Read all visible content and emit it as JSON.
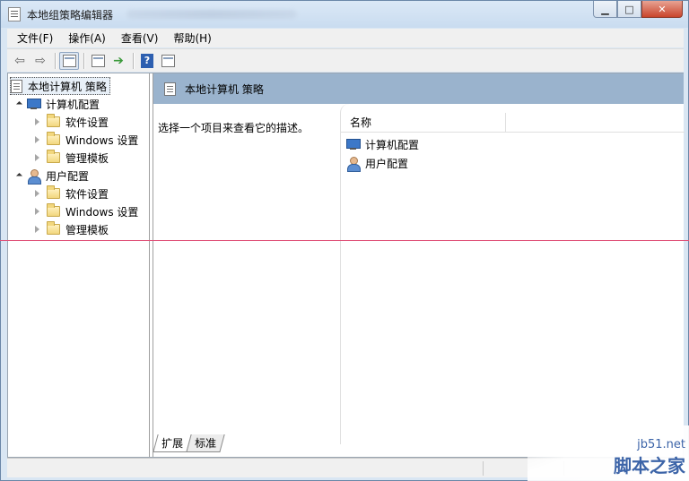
{
  "window": {
    "title": "本地组策略编辑器"
  },
  "window_buttons": {
    "minimize": "▁",
    "maximize": "□",
    "close": "✕"
  },
  "menu": [
    "文件(F)",
    "操作(A)",
    "查看(V)",
    "帮助(H)"
  ],
  "toolbar": {
    "back_icon": "back-arrow-icon",
    "forward_icon": "forward-arrow-icon",
    "help_label": "?"
  },
  "tree": {
    "root": "本地计算机 策略",
    "computer": {
      "label": "计算机配置",
      "children": [
        "软件设置",
        "Windows 设置",
        "管理模板"
      ]
    },
    "user": {
      "label": "用户配置",
      "children": [
        "软件设置",
        "Windows 设置",
        "管理模板"
      ]
    }
  },
  "right_pane": {
    "banner_title": "本地计算机 策略",
    "description": "选择一个项目来查看它的描述。",
    "column_header": "名称",
    "items": [
      "计算机配置",
      "用户配置"
    ]
  },
  "tabs": [
    "扩展",
    "标准"
  ],
  "watermark": {
    "url": "jb51.net",
    "text": "脚本之家"
  },
  "colors": {
    "banner": "#9ab3cd",
    "red_line": "#e0547a",
    "accent": "#3c64a8"
  }
}
